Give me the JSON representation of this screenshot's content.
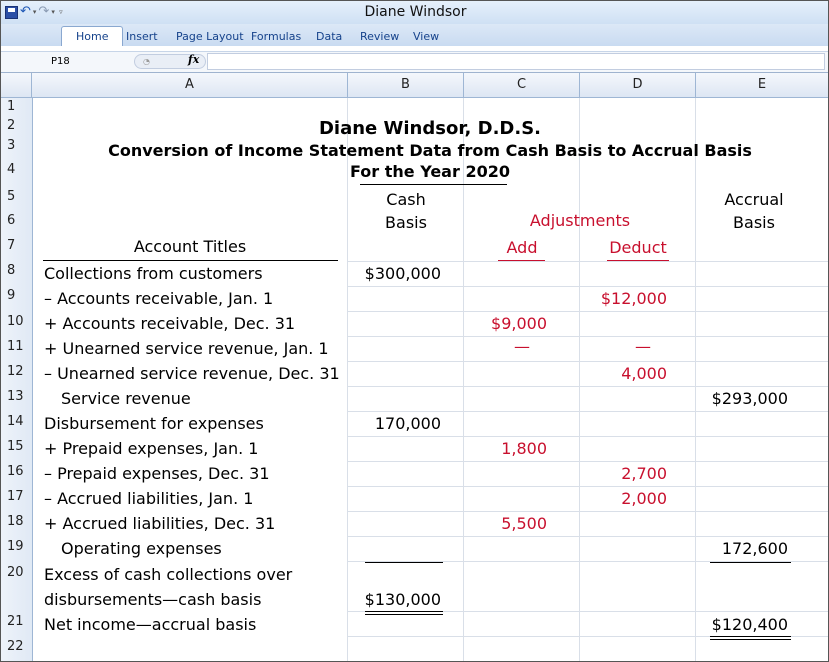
{
  "window": {
    "title": "Diane Windsor"
  },
  "ribbon": {
    "tabs": [
      "Home",
      "Insert",
      "Page Layout",
      "Formulas",
      "Data",
      "Review",
      "View"
    ]
  },
  "formula_bar": {
    "name_box": "P18",
    "fx_label": "fx",
    "formula": ""
  },
  "columns": [
    "A",
    "B",
    "C",
    "D",
    "E"
  ],
  "rows": [
    "1",
    "2",
    "3",
    "4",
    "5",
    "6",
    "7",
    "8",
    "9",
    "10",
    "11",
    "12",
    "13",
    "14",
    "15",
    "16",
    "17",
    "18",
    "19",
    "20",
    "21",
    "22"
  ],
  "sheet": {
    "title": "Diane Windsor, D.D.S.",
    "subtitle": "Conversion of Income Statement Data from Cash Basis to Accrual Basis",
    "period": "For the Year 2020",
    "headers": {
      "account_titles": "Account Titles",
      "cash": "Cash",
      "basis_b": "Basis",
      "adjustments": "Adjustments",
      "add": "Add",
      "deduct": "Deduct",
      "accrual": "Accrual",
      "basis_e": "Basis"
    },
    "lines": [
      {
        "label": "Collections from customers",
        "cash": "$300,000",
        "add": "",
        "deduct": "",
        "accrual": ""
      },
      {
        "label": "– Accounts receivable, Jan. 1",
        "cash": "",
        "add": "",
        "deduct": "$12,000",
        "accrual": ""
      },
      {
        "label": "+ Accounts receivable, Dec. 31",
        "cash": "",
        "add": "$9,000",
        "deduct": "",
        "accrual": ""
      },
      {
        "label": "+ Unearned service revenue, Jan. 1",
        "cash": "",
        "add": "—",
        "deduct": "—",
        "accrual": ""
      },
      {
        "label": "– Unearned service revenue, Dec. 31",
        "cash": "",
        "add": "",
        "deduct": "4,000",
        "accrual": ""
      },
      {
        "label": "Service revenue",
        "cash": "",
        "add": "",
        "deduct": "",
        "accrual": "$293,000"
      },
      {
        "label": "Disbursement for expenses",
        "cash": "170,000",
        "add": "",
        "deduct": "",
        "accrual": ""
      },
      {
        "label": "+ Prepaid expenses, Jan. 1",
        "cash": "",
        "add": "1,800",
        "deduct": "",
        "accrual": ""
      },
      {
        "label": "– Prepaid expenses, Dec. 31",
        "cash": "",
        "add": "",
        "deduct": "2,700",
        "accrual": ""
      },
      {
        "label": "– Accrued liabilities, Jan. 1",
        "cash": "",
        "add": "",
        "deduct": "2,000",
        "accrual": ""
      },
      {
        "label": "+ Accrued liabilities, Dec. 31",
        "cash": "",
        "add": "5,500",
        "deduct": "",
        "accrual": ""
      },
      {
        "label": "Operating expenses",
        "cash": "",
        "add": "",
        "deduct": "",
        "accrual": "172,600"
      },
      {
        "label": "Excess of cash collections over",
        "cash": "",
        "add": "",
        "deduct": "",
        "accrual": ""
      },
      {
        "label": "disbursements—cash basis",
        "cash": "$130,000",
        "add": "",
        "deduct": "",
        "accrual": ""
      },
      {
        "label": "Net income—accrual basis",
        "cash": "",
        "add": "",
        "deduct": "",
        "accrual": "$120,400"
      }
    ]
  }
}
